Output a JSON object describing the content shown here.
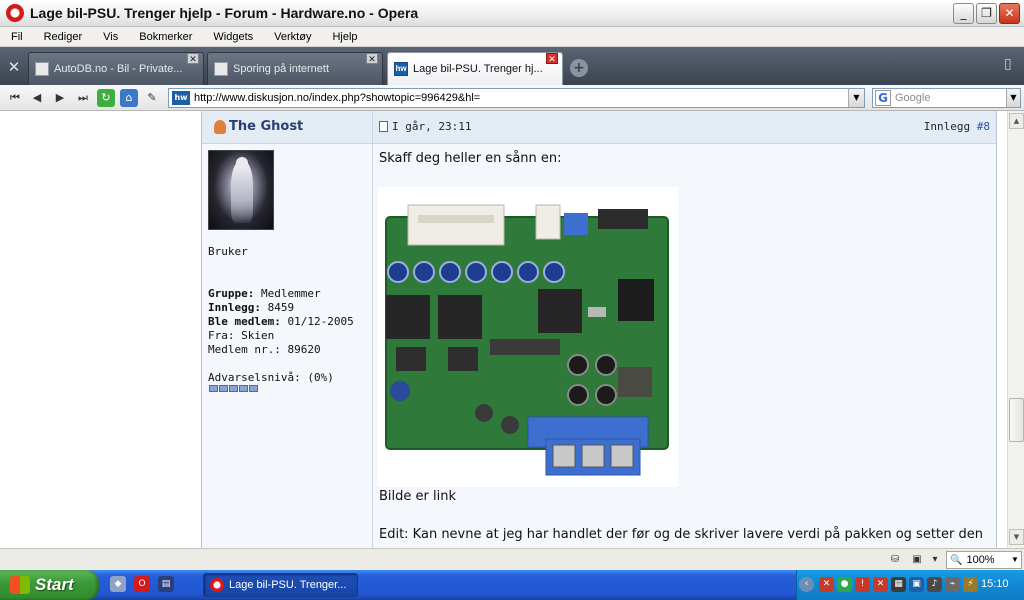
{
  "window": {
    "title": "Lage bil-PSU. Trenger hjelp - Forum - Hardware.no - Opera",
    "buttons": {
      "minimize": "_",
      "maximize": "❐",
      "close": "✕"
    }
  },
  "menu": [
    "Fil",
    "Rediger",
    "Vis",
    "Bokmerker",
    "Widgets",
    "Verktøy",
    "Hjelp"
  ],
  "tabs": [
    {
      "label": "AutoDB.no - Bil - Private...",
      "active": false
    },
    {
      "label": "Sporing på internett",
      "active": false
    },
    {
      "label": "Lage bil-PSU. Trenger hj...",
      "active": true
    }
  ],
  "address": {
    "url": "http://www.diskusjon.no/index.php?showtopic=996429&hl=",
    "favicon_text": "hw",
    "search_placeholder": "Google"
  },
  "post": {
    "author": "The Ghost",
    "date": "I går, 23:11",
    "post_label": "Innlegg",
    "post_number": "#8",
    "member_title": "Bruker",
    "profile": {
      "group_label": "Gruppe:",
      "group_value": "Medlemmer",
      "posts_label": "Innlegg:",
      "posts_value": "8459",
      "joined_label": "Ble medlem:",
      "joined_value": "01/12-2005",
      "from_line": "Fra: Skien",
      "member_no_line": "Medlem nr.: 89620",
      "warning_line": "Advarselsnivå: (0%)"
    },
    "warn_level_fraction": 0,
    "body": {
      "intro": "Skaff deg heller en sånn en:",
      "image_caption": "Bilde er link",
      "edit_text": "Edit: Kan nevne at jeg har handlet der før og de skriver lavere verdi på pakken og setter den"
    }
  },
  "status": {
    "zoom": "100%"
  },
  "taskbar": {
    "start_label": "Start",
    "task_label": "Lage bil-PSU. Trenger...",
    "clock": "15:10"
  },
  "colors": {
    "tab_bar": "#3b4350",
    "post_header": "#e3ebf4",
    "author_link": "#2a3f73",
    "taskbar": "#245edb",
    "start_button": "#3c9a38"
  }
}
